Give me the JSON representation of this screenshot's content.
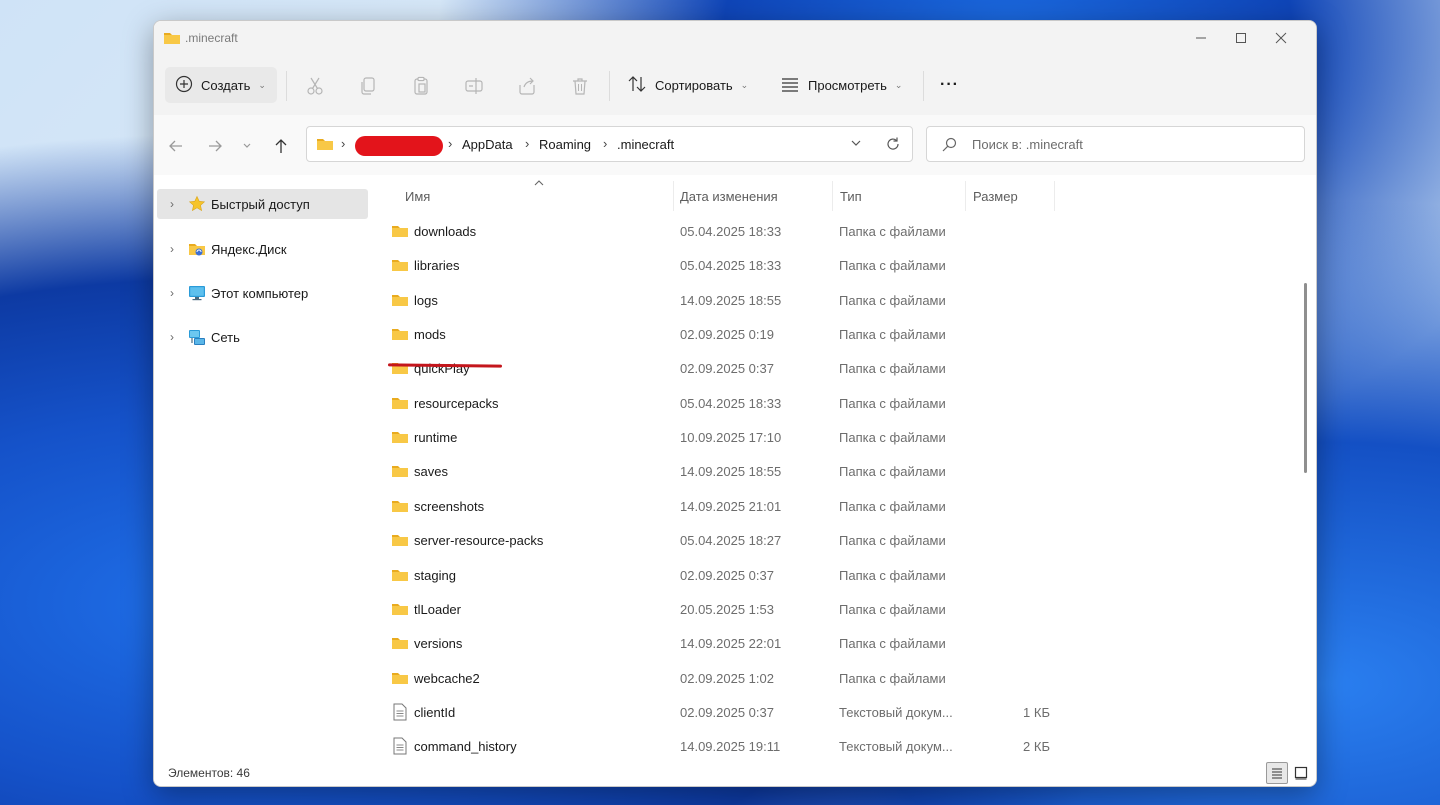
{
  "window": {
    "title": ".minecraft"
  },
  "toolbar": {
    "create_label": "Создать",
    "sort_label": "Сортировать",
    "view_label": "Просмотреть",
    "more_label": "···"
  },
  "address": {
    "crumbs": [
      "AppData",
      "Roaming",
      ".minecraft"
    ]
  },
  "search": {
    "placeholder": "Поиск в: .minecraft"
  },
  "sidebar": {
    "items": [
      {
        "label": "Быстрый доступ",
        "icon": "star-icon"
      },
      {
        "label": "Яндекс.Диск",
        "icon": "yandex-disk-icon"
      },
      {
        "label": "Этот компьютер",
        "icon": "computer-icon"
      },
      {
        "label": "Сеть",
        "icon": "network-icon"
      }
    ]
  },
  "columns": {
    "name": "Имя",
    "date": "Дата изменения",
    "type": "Тип",
    "size": "Размер"
  },
  "files": [
    {
      "name": "downloads",
      "date": "05.04.2025 18:33",
      "type": "Папка с файлами",
      "size": "",
      "kind": "folder"
    },
    {
      "name": "libraries",
      "date": "05.04.2025 18:33",
      "type": "Папка с файлами",
      "size": "",
      "kind": "folder"
    },
    {
      "name": "logs",
      "date": "14.09.2025 18:55",
      "type": "Папка с файлами",
      "size": "",
      "kind": "folder"
    },
    {
      "name": "mods",
      "date": "02.09.2025 0:19",
      "type": "Папка с файлами",
      "size": "",
      "kind": "folder"
    },
    {
      "name": "quickPlay",
      "date": "02.09.2025 0:37",
      "type": "Папка с файлами",
      "size": "",
      "kind": "folder"
    },
    {
      "name": "resourcepacks",
      "date": "05.04.2025 18:33",
      "type": "Папка с файлами",
      "size": "",
      "kind": "folder"
    },
    {
      "name": "runtime",
      "date": "10.09.2025 17:10",
      "type": "Папка с файлами",
      "size": "",
      "kind": "folder"
    },
    {
      "name": "saves",
      "date": "14.09.2025 18:55",
      "type": "Папка с файлами",
      "size": "",
      "kind": "folder"
    },
    {
      "name": "screenshots",
      "date": "14.09.2025 21:01",
      "type": "Папка с файлами",
      "size": "",
      "kind": "folder"
    },
    {
      "name": "server-resource-packs",
      "date": "05.04.2025 18:27",
      "type": "Папка с файлами",
      "size": "",
      "kind": "folder"
    },
    {
      "name": "staging",
      "date": "02.09.2025 0:37",
      "type": "Папка с файлами",
      "size": "",
      "kind": "folder"
    },
    {
      "name": "tlLoader",
      "date": "20.05.2025 1:53",
      "type": "Папка с файлами",
      "size": "",
      "kind": "folder"
    },
    {
      "name": "versions",
      "date": "14.09.2025 22:01",
      "type": "Папка с файлами",
      "size": "",
      "kind": "folder"
    },
    {
      "name": "webcache2",
      "date": "02.09.2025 1:02",
      "type": "Папка с файлами",
      "size": "",
      "kind": "folder"
    },
    {
      "name": "clientId",
      "date": "02.09.2025 0:37",
      "type": "Текстовый докум...",
      "size": "1 КБ",
      "kind": "file"
    },
    {
      "name": "command_history",
      "date": "14.09.2025 19:11",
      "type": "Текстовый докум...",
      "size": "2 КБ",
      "kind": "file"
    }
  ],
  "status": {
    "items_count": "Элементов: 46"
  },
  "colors": {
    "folder": "#f8c846",
    "folder_dark": "#e9ab1f",
    "highlight_mark": "#c4161c",
    "redaction": "#e3141b",
    "selected_bg": "#e5e5e5"
  }
}
